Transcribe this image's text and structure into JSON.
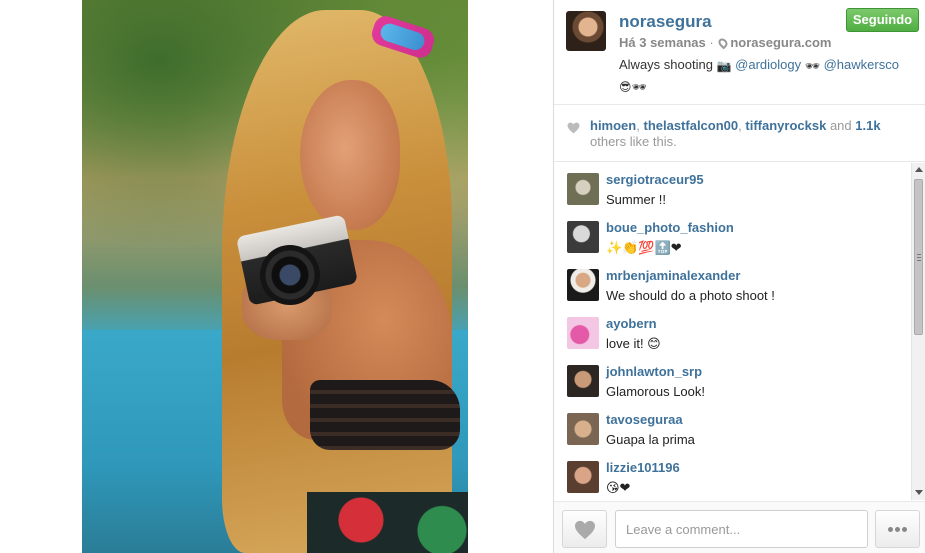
{
  "post": {
    "username": "norasegura",
    "follow_label": "Seguindo",
    "time": "Há 3 semanas",
    "separator": "·",
    "location": "norasegura.com",
    "caption": {
      "prefix": "Always shooting",
      "camera_emoji": "📷",
      "mention1": "@ardiology",
      "glasses_emoji": "🕶",
      "mention2": "@hawkersco",
      "end_emojis": "😎🕶"
    }
  },
  "likes": {
    "likers": [
      "himoen",
      "thelastfalcon00",
      "tiffanyrocksk"
    ],
    "sep": ",",
    "and_text": "and",
    "count": "1.1k",
    "tail": "others like this."
  },
  "comments": [
    {
      "user": "sergiotraceur95",
      "text": "Summer !!",
      "avatar_color": "#7a7b66"
    },
    {
      "user": "boue_photo_fashion",
      "text": "✨👏💯🔝❤",
      "avatar_color": "#4a4a4a"
    },
    {
      "user": "mrbenjaminalexander",
      "text": "We should do a photo shoot !",
      "avatar_color": "#6e5a4b"
    },
    {
      "user": "ayobern",
      "text": "love it! 😊",
      "avatar_color": "#d69bc6"
    },
    {
      "user": "johnlawton_srp",
      "text": "Glamorous Look!",
      "avatar_color": "#3c3530"
    },
    {
      "user": "tavoseguraa",
      "text": "Guapa la prima",
      "avatar_color": "#a88a6e"
    },
    {
      "user": "lizzie101196",
      "text": "😘❤",
      "avatar_color": "#8d6b5a"
    }
  ],
  "footer": {
    "comment_placeholder": "Leave a comment..."
  },
  "colors": {
    "link": "#3f729b",
    "follow_green": "#4fae42",
    "muted": "#999999"
  },
  "icons": {
    "location": "pin-icon",
    "like": "heart-icon",
    "more": "ellipsis-icon"
  }
}
